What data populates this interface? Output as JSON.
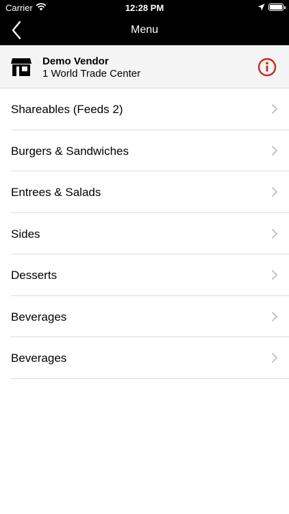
{
  "status_bar": {
    "carrier": "Carrier",
    "time": "12:28 PM"
  },
  "nav": {
    "title": "Menu",
    "back_icon": "chevron-left-icon"
  },
  "vendor": {
    "name": "Demo Vendor",
    "address": "1 World Trade Center",
    "icon": "storefront-icon",
    "info_icon": "info-icon",
    "info_color": "#c8281e"
  },
  "menu": {
    "items": [
      {
        "label": "Shareables (Feeds 2)"
      },
      {
        "label": "Burgers & Sandwiches"
      },
      {
        "label": "Entrees & Salads"
      },
      {
        "label": "Sides"
      },
      {
        "label": "Desserts"
      },
      {
        "label": "Beverages"
      },
      {
        "label": "Beverages"
      }
    ]
  }
}
